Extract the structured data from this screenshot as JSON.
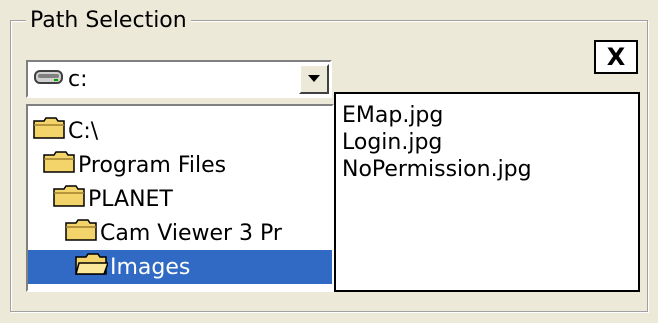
{
  "panel": {
    "title": "Path Selection",
    "close_label": "X"
  },
  "drive_combo": {
    "value": "c:",
    "icon": "drive-icon"
  },
  "folder_tree": {
    "items": [
      {
        "label": "C:\\",
        "icon": "folder-icon",
        "depth": 0,
        "selected": false
      },
      {
        "label": "Program Files",
        "icon": "folder-icon",
        "depth": 1,
        "selected": false
      },
      {
        "label": "PLANET",
        "icon": "folder-icon",
        "depth": 2,
        "selected": false
      },
      {
        "label": "Cam Viewer 3 Pr",
        "icon": "folder-icon",
        "depth": 3,
        "selected": false
      },
      {
        "label": "Images",
        "icon": "folder-open-icon",
        "depth": 4,
        "selected": true
      }
    ]
  },
  "file_list": {
    "items": [
      "EMap.jpg",
      "Login.jpg",
      "NoPermission.jpg"
    ]
  },
  "colors": {
    "background": "#ece9d8",
    "selection": "#316ac5",
    "folder": "#f2d46a"
  }
}
